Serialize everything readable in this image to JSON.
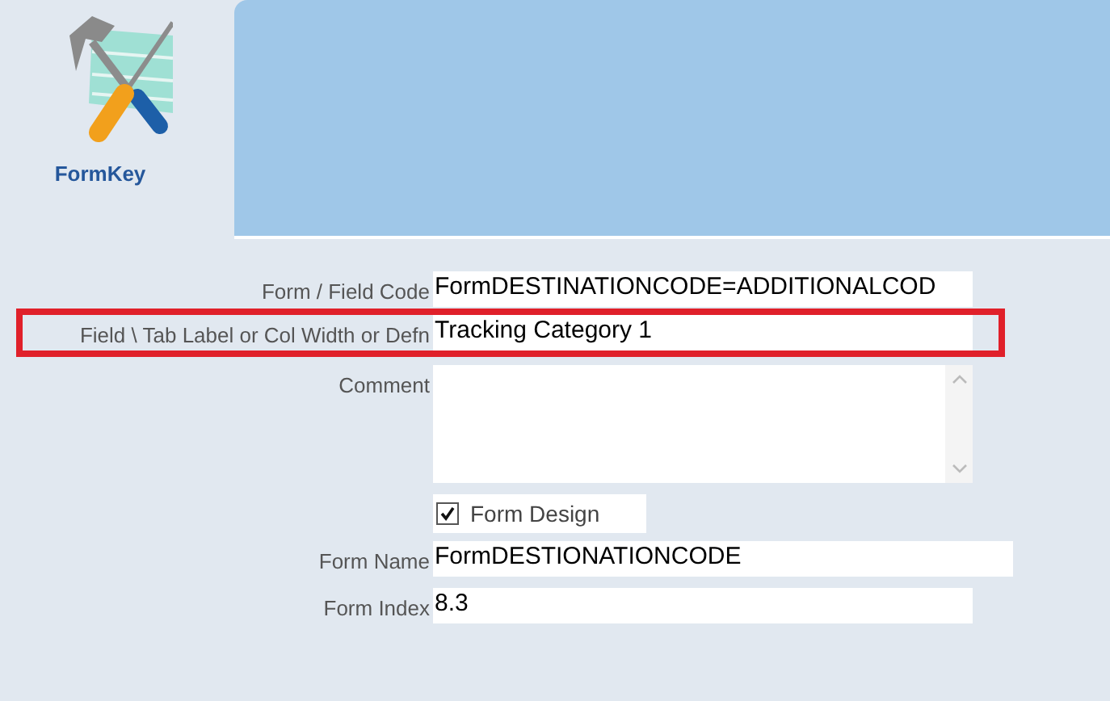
{
  "app": {
    "name": "FormKey"
  },
  "fields": [
    {
      "kind": "text",
      "label": "Form / Field Code",
      "value": "FormDESTINATIONCODE=ADDITIONALCOD",
      "highlighted": false
    },
    {
      "kind": "text",
      "label": "Field \\ Tab Label or Col Width or Defn",
      "value": "Tracking Category 1",
      "highlighted": true
    },
    {
      "kind": "textarea",
      "label": "Comment",
      "highlighted": false
    },
    {
      "kind": "checkbox",
      "label": "Form Design",
      "checked": true,
      "highlighted": false
    },
    {
      "kind": "text",
      "label": "Form Name",
      "value": "FormDESTIONATIONCODE",
      "highlighted": false
    },
    {
      "kind": "text",
      "label": "Form Index",
      "value": "8.3",
      "highlighted": false
    }
  ]
}
